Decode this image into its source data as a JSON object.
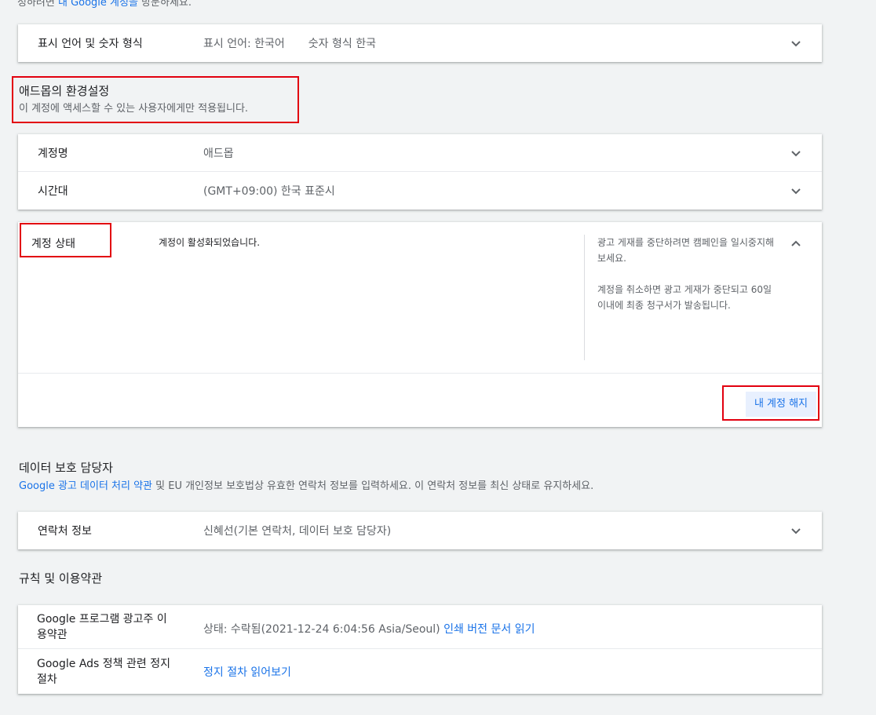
{
  "top_partial": {
    "text_before": "정하려면",
    "link": "내 Google 계정을",
    "text_after": "방문하세요."
  },
  "language_card": {
    "label": "표시 언어 및 숫자 형식",
    "display_language": "표시 언어: 한국어",
    "number_format": "숫자 형식 한국"
  },
  "admob_prefs": {
    "title": "애드몹의 환경설정",
    "subtitle": "이 계정에 액세스할 수 있는 사용자에게만 적용됩니다."
  },
  "account_card": {
    "rows": [
      {
        "label": "계정명",
        "value": "애드몹"
      },
      {
        "label": "시간대",
        "value": "(GMT+09:00) 한국 표준시"
      }
    ]
  },
  "account_status": {
    "label": "계정 상태",
    "value": "계정이 활성화되었습니다.",
    "help_pause": "광고 게재를 중단하려면 캠페인을 일시중지해 보세요.",
    "help_cancel": "계정을 취소하면 광고 게재가 중단되고 60일 이내에 최종 청구서가 발송됩니다.",
    "cancel_button": "내 계정 해지"
  },
  "data_protection": {
    "title": "데이터 보호 담당자",
    "link": "Google 광고 데이터 처리 약관",
    "text": " 및 EU 개인정보 보호법상 유효한 연락처 정보를 입력하세요. 이 연락처 정보를 최신 상태로 유지하세요.",
    "contact_label": "연락처 정보",
    "contact_value": "신혜선(기본 연락처, 데이터 보호 담당자)"
  },
  "terms": {
    "title": "규칙 및 이용약관",
    "rows": [
      {
        "label": "Google 프로그램 광고주 이용약관",
        "status": "상태: 수락됨(2021-12-24 6:04:56 Asia/Seoul)",
        "link": "인쇄 버전 문서 읽기"
      },
      {
        "label": "Google Ads 정책 관련 정지 절차",
        "link": "정지 절차 읽어보기"
      }
    ]
  },
  "colors": {
    "highlight_border": "#e2000f",
    "link": "#1a73e8",
    "background": "#f1f3f4"
  },
  "icons": {
    "expand": "chevron-down-icon",
    "collapse": "chevron-up-icon"
  }
}
